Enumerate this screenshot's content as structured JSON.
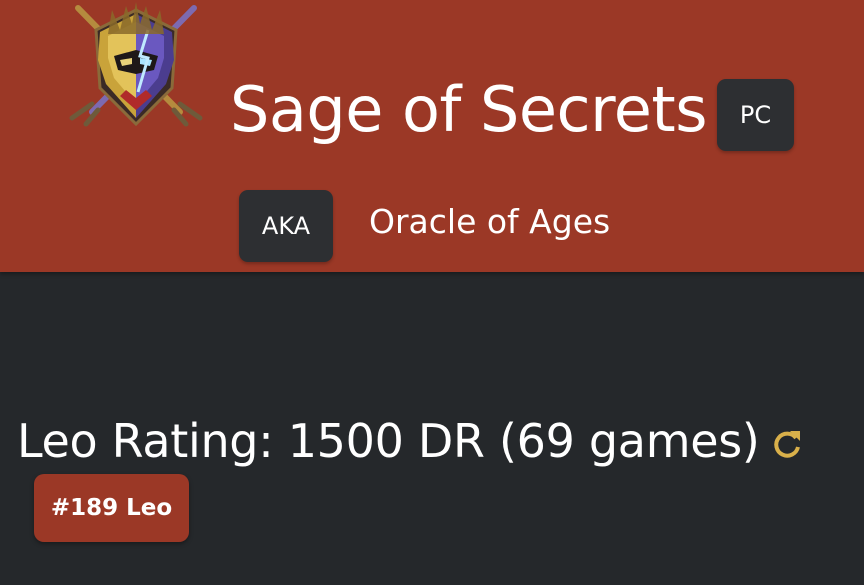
{
  "header": {
    "player_name": "Sage of Secrets",
    "platform": "PC",
    "aka_label": "AKA",
    "alias": "Oracle of Ages",
    "emblem_icon": "knight-helmet-emblem-icon",
    "background_color": "#9b3826"
  },
  "rating": {
    "text": "Leo Rating: 1500 DR (69 games)",
    "refresh_icon": "refresh-icon",
    "refresh_color": "#d9b04a",
    "rank_label": "#189 Leo"
  },
  "colors": {
    "page_background": "#25282b",
    "badge_background": "#2d2f32",
    "accent": "#9b3826"
  }
}
